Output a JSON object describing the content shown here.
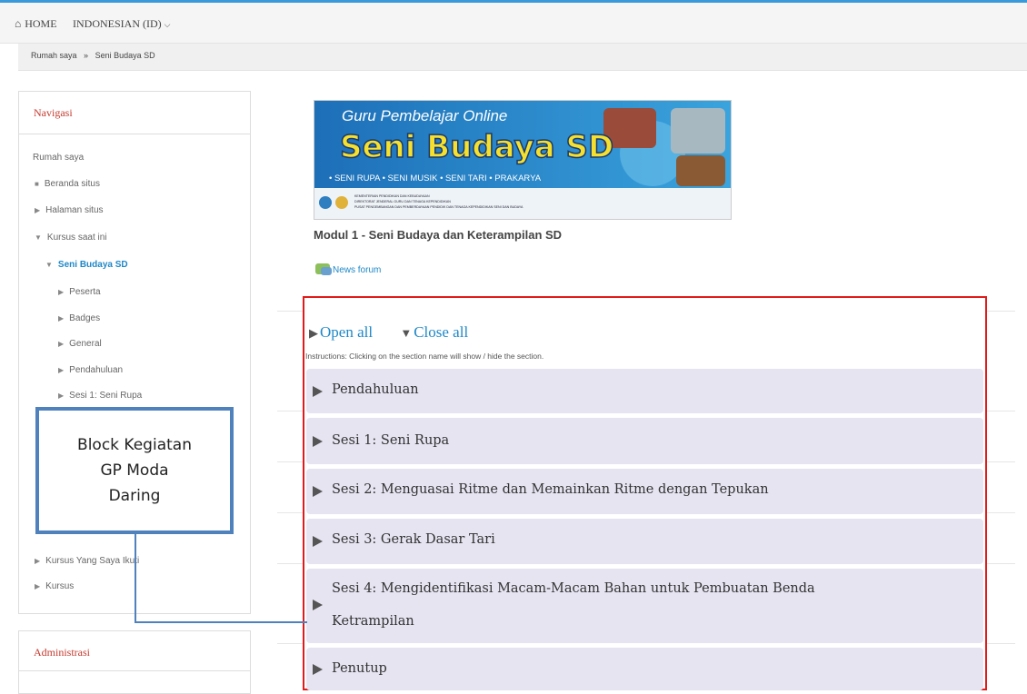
{
  "topbar": {
    "home": "HOME",
    "language": "INDONESIAN (ID)"
  },
  "breadcrumb": {
    "items": [
      "Rumah saya",
      "Seni Budaya SD"
    ],
    "separator": "»"
  },
  "navigation": {
    "title": "Navigasi",
    "items": [
      {
        "label": "Rumah saya"
      },
      {
        "label": "Beranda situs"
      },
      {
        "label": "Halaman situs"
      },
      {
        "label": "Kursus saat ini"
      },
      {
        "label": "Seni Budaya SD"
      },
      {
        "label": "Peserta"
      },
      {
        "label": "Badges"
      },
      {
        "label": "General"
      },
      {
        "label": "Pendahuluan"
      },
      {
        "label": "Sesi 1: Seni Rupa"
      },
      {
        "label": "Kursus Yang Saya Ikuti"
      },
      {
        "label": "Kursus"
      }
    ]
  },
  "administration": {
    "title": "Administrasi"
  },
  "callout": {
    "lines": [
      "Block Kegiatan",
      "GP Moda",
      "Daring"
    ]
  },
  "banner": {
    "top_line": "Guru Pembelajar Online",
    "big_title": "Seni Budaya SD",
    "tags": "• SENI RUPA • SENI MUSIK • SENI TARI • PRAKARYA",
    "agency_lines": [
      "KEMENTERIAN PENDIDIKAN DAN KEBUDAYAAN",
      "DIREKTORAT JENDERAL GURU DAN TENAGA KEPENDIDIKAN",
      "PUSAT PENGEMBANGAN DAN PEMBERDAYAAN PENDIDIK DAN TENAGA KEPENDIDIKAN SENI DAN BUDAYA"
    ]
  },
  "main": {
    "module_title": "Modul 1 - Seni Budaya dan Keterampilan SD",
    "news_forum": "News forum",
    "open_all": "Open all",
    "close_all": "Close all",
    "instructions": "Instructions: Clicking on the section name will show / hide the section.",
    "sections": [
      {
        "label": "Pendahuluan"
      },
      {
        "label": "Sesi 1: Seni Rupa"
      },
      {
        "label": "Sesi 2: Menguasai Ritme dan Memainkan Ritme dengan Tepukan"
      },
      {
        "label": "Sesi 3: Gerak Dasar Tari"
      },
      {
        "label": "Sesi 4: Mengidentifikasi Macam-Macam Bahan untuk Pembuatan Benda",
        "label2": "Ketrampilan"
      },
      {
        "label": "Penutup"
      }
    ]
  },
  "colors": {
    "accent": "#1e88c7",
    "block_title": "#c53a2f",
    "highlight": "#e11a1a",
    "callout": "#4f81bd"
  }
}
